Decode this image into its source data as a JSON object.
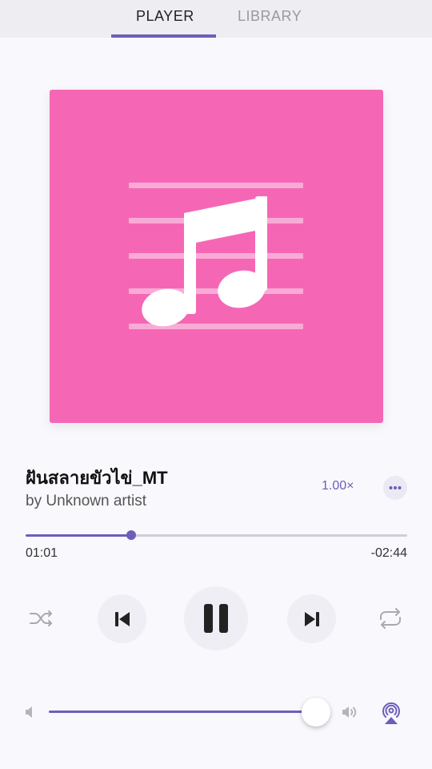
{
  "tabs": {
    "player": "PLAYER",
    "library": "LIBRARY",
    "active": "PLAYER"
  },
  "artwork": {
    "background_color": "#f567b4",
    "icon": "music-note-icon"
  },
  "track": {
    "title": "ฝันสลายขัวไข่_MT",
    "artist": "by Unknown artist"
  },
  "playback": {
    "speed": "1.00×",
    "elapsed": "01:01",
    "remaining": "-02:44",
    "progress_fraction": 0.277,
    "state": "playing"
  },
  "volume": {
    "level_fraction": 1.0
  },
  "icons": {
    "shuffle": "shuffle-icon",
    "previous": "skip-previous-icon",
    "pause": "pause-icon",
    "next": "skip-next-icon",
    "repeat": "repeat-icon",
    "volume_low": "volume-low-icon",
    "volume_high": "volume-high-icon",
    "airplay": "airplay-icon",
    "more": "more-icon"
  },
  "colors": {
    "accent": "#6c5fb8",
    "background": "#f9f8fd",
    "tab_bar": "#eeedf2"
  }
}
